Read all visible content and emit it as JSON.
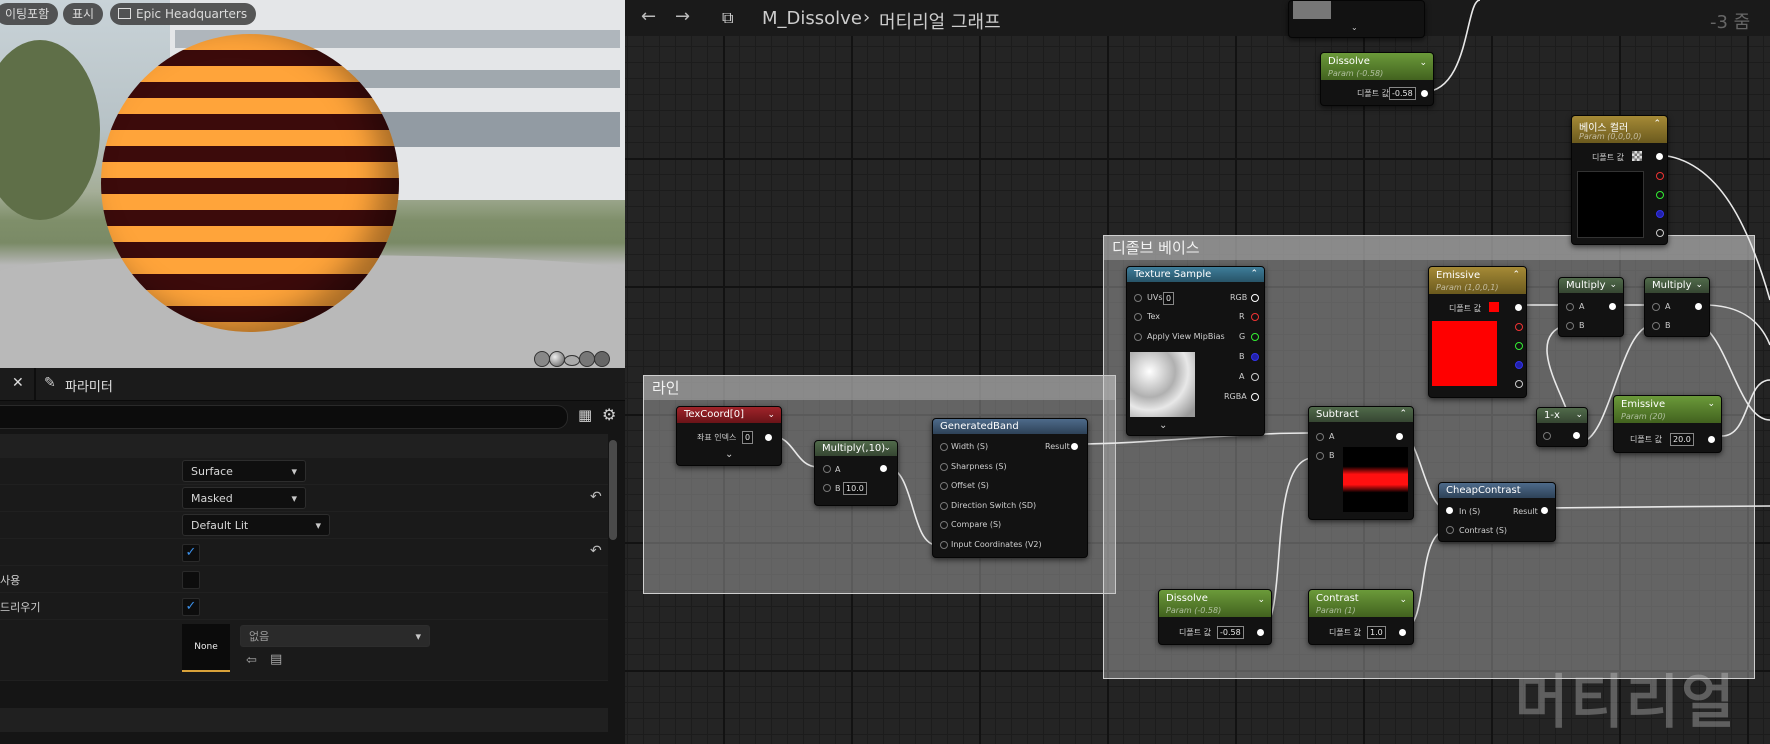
{
  "viewport": {
    "buttons": [
      "이팅포함",
      "표시",
      "Epic Headquarters"
    ]
  },
  "details": {
    "tab_label": "파라미터",
    "rows": [
      {
        "label": "",
        "value": "Surface"
      },
      {
        "label": "",
        "value": "Masked"
      },
      {
        "label": "",
        "value": "Default Lit"
      },
      {
        "label": "",
        "checked": true
      },
      {
        "label": "사용",
        "checked": false
      },
      {
        "label": "드리우기",
        "checked": true
      }
    ],
    "texture": {
      "thumb_label": "None",
      "combo": "없음"
    }
  },
  "graph": {
    "breadcrumb_asset": "M_Dissolve",
    "breadcrumb_graph": "머티리얼 그래프",
    "zoom": "-3 줌",
    "watermark": "머티리얼",
    "comments": {
      "line": "라인",
      "dissolve_base": "디졸브 베이스"
    },
    "default_value_label": "디폴트 값",
    "nodes": {
      "texcoord": {
        "title": "TexCoord[0]",
        "input_label": "좌표 인덱스",
        "input_value": "0"
      },
      "multiply10": {
        "title": "Multiply(,10)",
        "a": "A",
        "b": "B",
        "b_value": "10.0"
      },
      "generatedband": {
        "title": "GeneratedBand",
        "result": "Result",
        "inputs": [
          "Width (S)",
          "Sharpness (S)",
          "Offset (S)",
          "Direction Switch (SD)",
          "Compare (S)",
          "Input Coordinates (V2)"
        ]
      },
      "texsample": {
        "title": "Texture Sample",
        "uvs": "UVs",
        "uvs_value": "0",
        "tex": "Tex",
        "mip": "Apply View MipBias",
        "outputs": [
          "RGB",
          "R",
          "G",
          "B",
          "A",
          "RGBA"
        ]
      },
      "dissolve_top": {
        "title": "Dissolve",
        "sub": "Param (-0.58)",
        "value": "-0.58"
      },
      "dissolve_bottom": {
        "title": "Dissolve",
        "sub": "Param (-0.58)",
        "value": "-0.58"
      },
      "basecolor": {
        "title": "베이스 컬러",
        "sub": "Param (0,0,0,0)"
      },
      "emissive_color": {
        "title": "Emissive",
        "sub": "Param (1,0,0,1)"
      },
      "emissive_scalar": {
        "title": "Emissive",
        "sub": "Param (20)",
        "value": "20.0"
      },
      "subtract": {
        "title": "Subtract",
        "a": "A",
        "b": "B"
      },
      "cheapcontrast": {
        "title": "CheapContrast",
        "in": "In (S)",
        "contrast": "Contrast (S)",
        "result": "Result"
      },
      "contrast": {
        "title": "Contrast",
        "sub": "Param (1)",
        "value": "1.0"
      },
      "multiply_a": {
        "title": "Multiply",
        "a": "A",
        "b": "B"
      },
      "multiply_b": {
        "title": "Multiply",
        "a": "A",
        "b": "B"
      },
      "oneminus": {
        "title": "1-x"
      }
    }
  },
  "colors": {
    "accent": "#3b8fe8",
    "emissive": "#ff0000",
    "sphere_orange": "#ffa43a",
    "sphere_dark": "#3c0b0b"
  }
}
